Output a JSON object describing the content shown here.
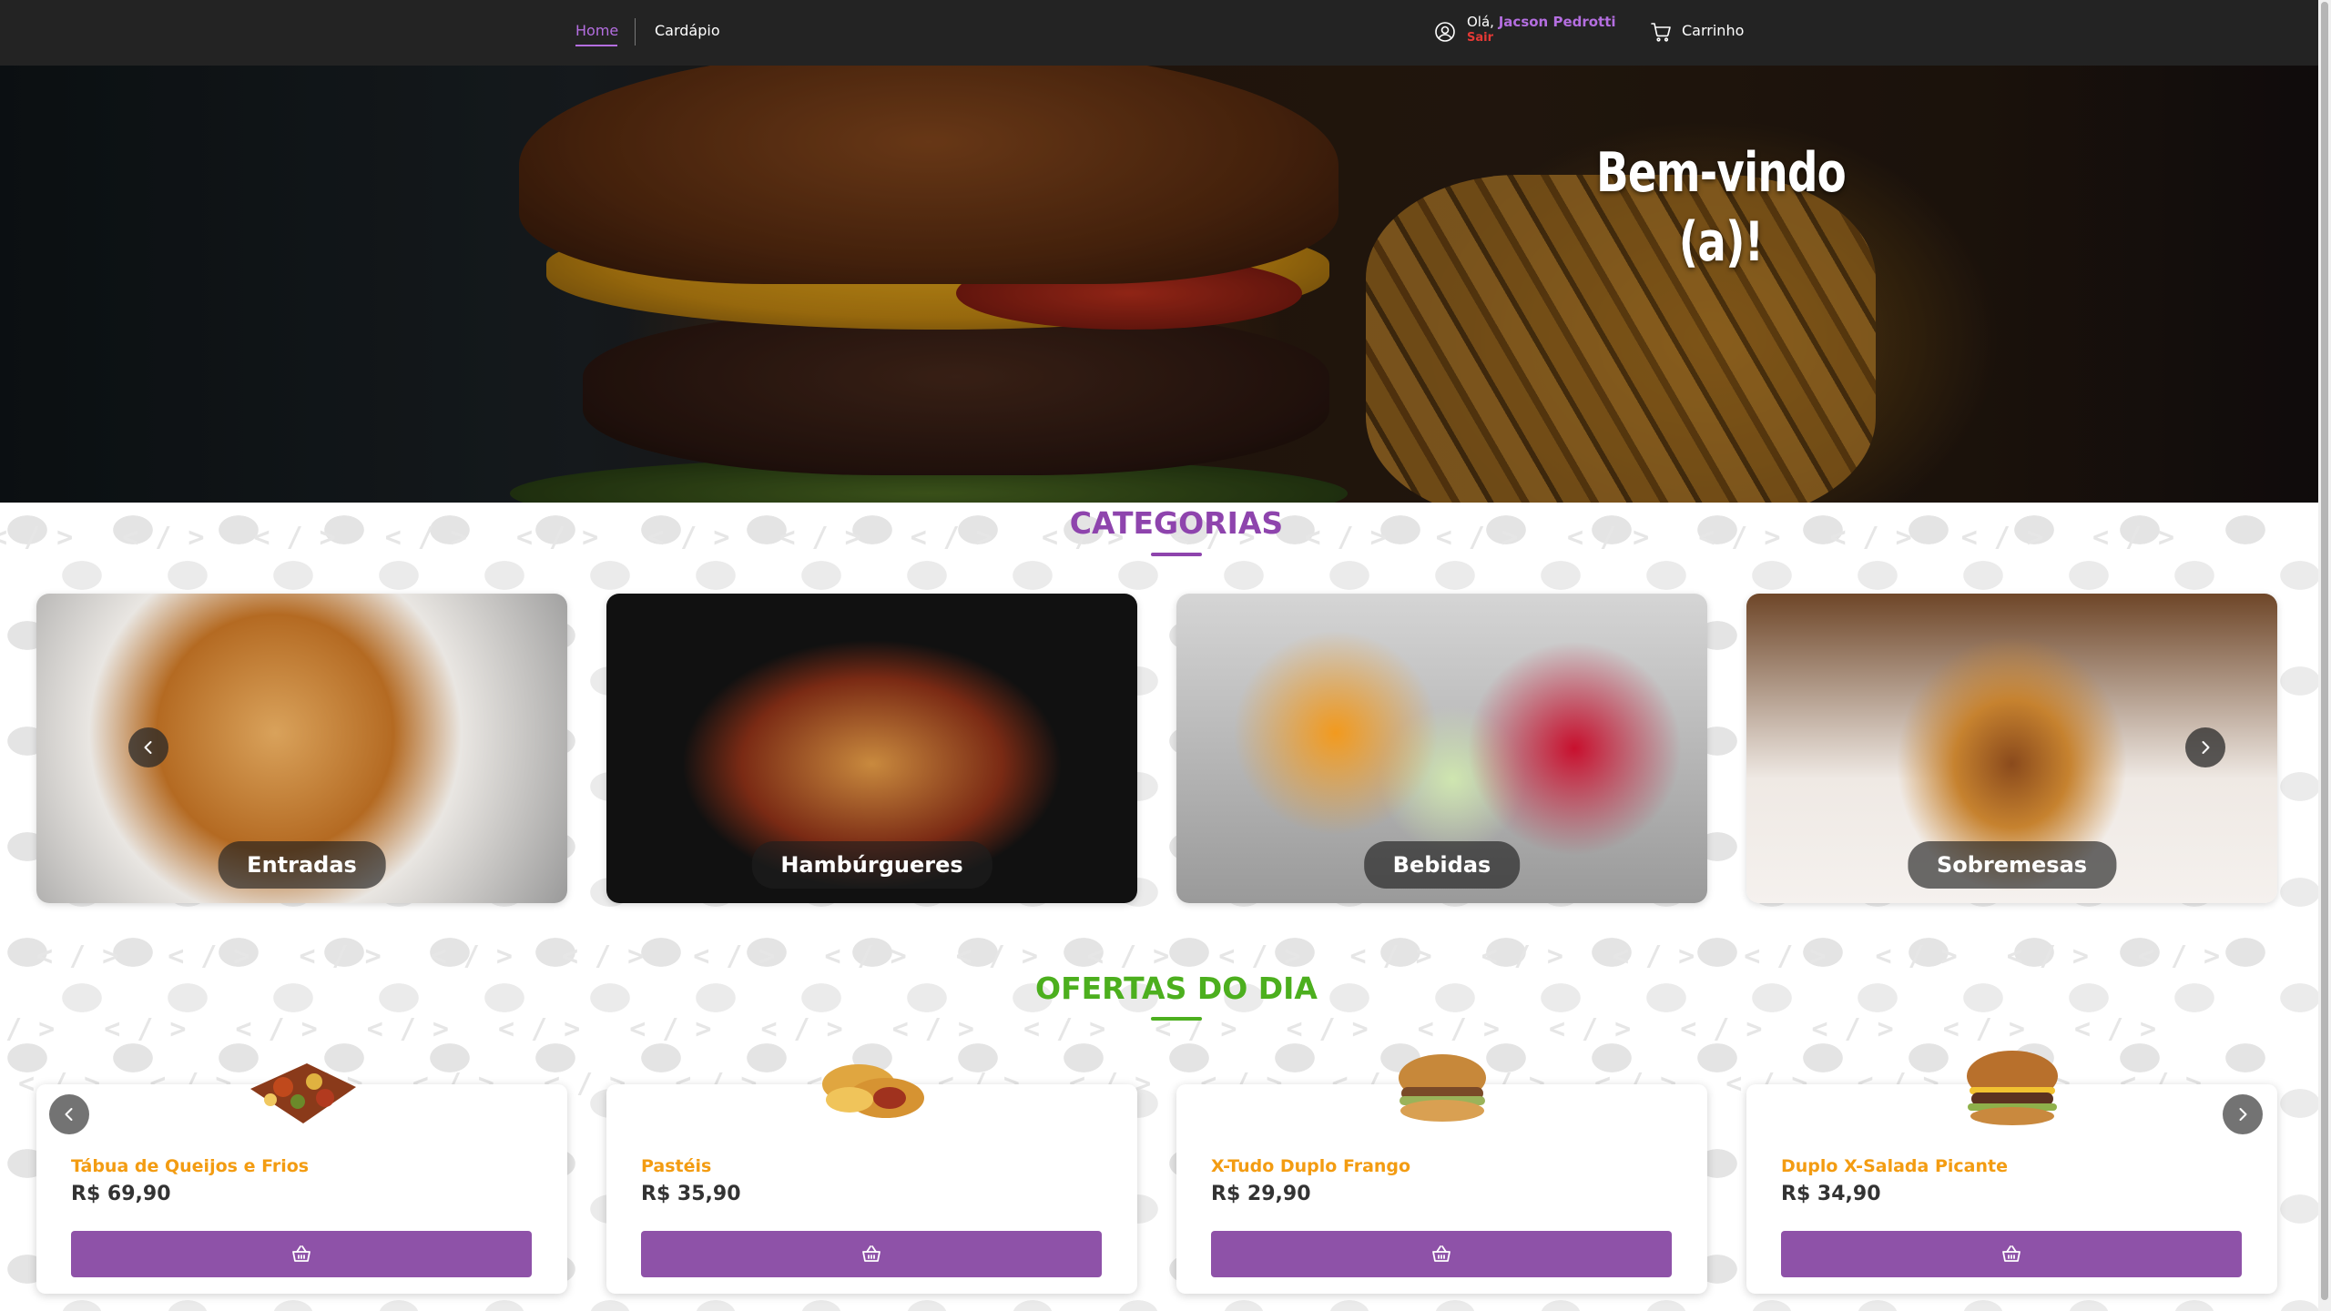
{
  "nav": {
    "home": "Home",
    "menu": "Cardápio",
    "greeting": "Olá,",
    "user_name": "Jacson Pedrotti",
    "logout": "Sair",
    "cart": "Carrinho"
  },
  "hero": {
    "title": "Bem-vindo (a)!"
  },
  "categories": {
    "title": "CATEGORIAS",
    "items": [
      {
        "label": "Entradas"
      },
      {
        "label": "Hambúrgueres"
      },
      {
        "label": "Bebidas"
      },
      {
        "label": "Sobremesas"
      }
    ]
  },
  "offers": {
    "title": "OFERTAS DO DIA",
    "items": [
      {
        "name": "Tábua de Queijos e Frios",
        "price": "R$ 69,90"
      },
      {
        "name": "Pastéis",
        "price": "R$ 35,90"
      },
      {
        "name": "X-Tudo Duplo Frango",
        "price": "R$ 29,90"
      },
      {
        "name": "Duplo X-Salada Picante",
        "price": "R$ 34,90"
      }
    ]
  },
  "icons": {
    "user": "user-circle-icon",
    "cart": "cart-icon",
    "prev": "chevron-left-icon",
    "next": "chevron-right-icon",
    "add_to_cart": "basket-icon"
  },
  "colors": {
    "navbar": "#232323",
    "accent_purple": "#8e44ad",
    "accent_green": "#4caf1e",
    "price_orange": "#f39c12",
    "button_purple": "#8e52a8",
    "logout_red": "#e53935"
  }
}
